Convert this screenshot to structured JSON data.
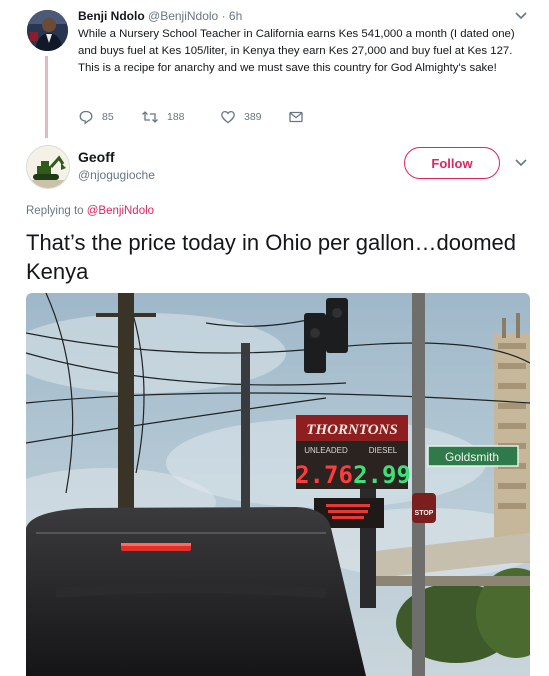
{
  "parent_tweet": {
    "author_name": "Benji Ndolo",
    "author_handle": "@BenjiNdolo",
    "separator": "·",
    "time": "6h",
    "text": "While a Nursery School Teacher in California earns Kes 541,000 a month (I dated one) and buys fuel at Kes 105/liter, in Kenya they earn Kes 27,000 and buy fuel at Kes 127. This is a recipe for anarchy and we must save this country for God Almighty's sake!",
    "actions": {
      "replies": "85",
      "retweets": "188",
      "likes": "389"
    }
  },
  "reply_tweet": {
    "author_name": "Geoff",
    "author_handle": "@njogugioche",
    "follow_label": "Follow",
    "replying_prefix": "Replying to",
    "replying_to": "@BenjiNdolo",
    "text": "That’s the price today in Ohio per gallon…doomed Kenya",
    "photo": {
      "sign_brand": "THORNTONS",
      "label_unleaded": "UNLEADED",
      "label_diesel": "DIESEL",
      "price_unleaded": "2.76",
      "price_diesel": "2.99",
      "street_sign": "Goldsmith",
      "stop_sign": "STOP"
    }
  },
  "icons": {
    "reply": "reply-icon",
    "retweet": "retweet-icon",
    "like": "heart-icon",
    "message": "envelope-icon",
    "caret": "chevron-down-icon"
  },
  "colors": {
    "accent": "#e0245e",
    "thread_line": "#e2b9c3",
    "secondary_text": "#657786",
    "primary_text": "#14171a"
  }
}
